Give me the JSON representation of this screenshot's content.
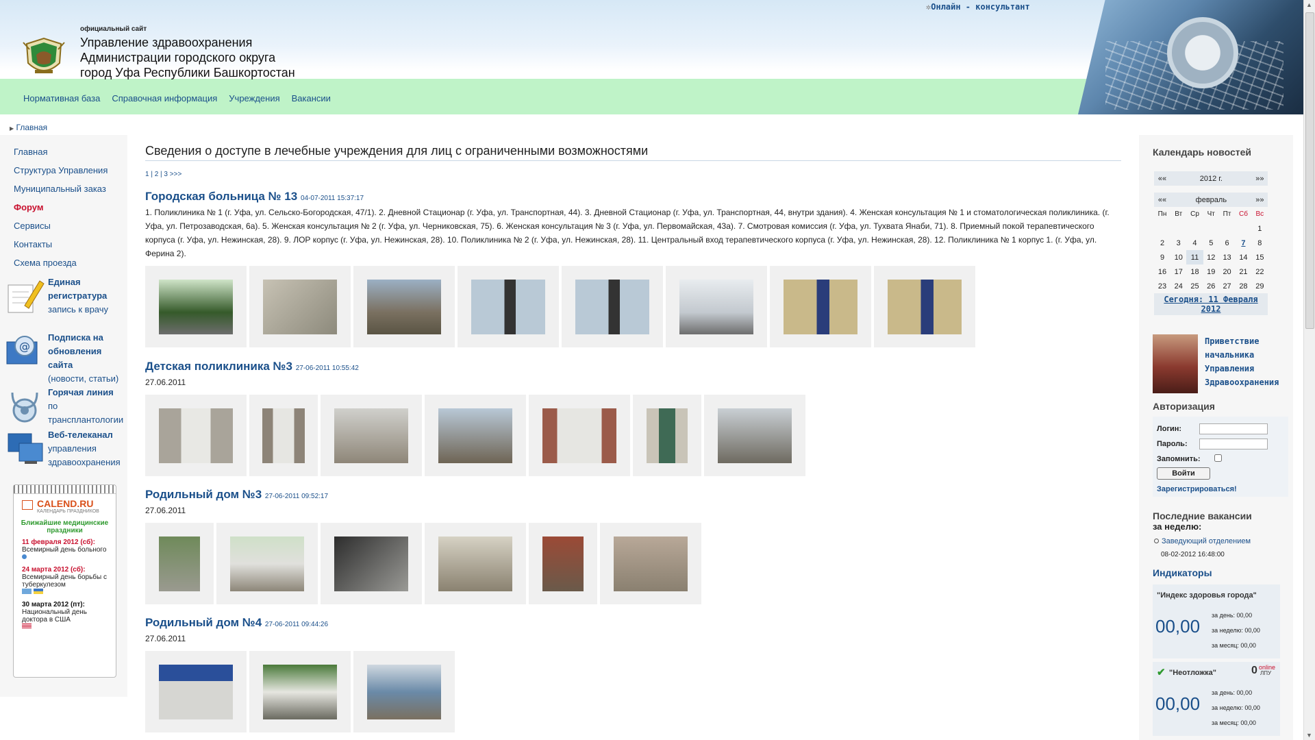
{
  "header": {
    "site_small": "официальный сайт",
    "title_line1": "Управление здравоохранения",
    "title_line2": "Администрации городского округа",
    "title_line3": "город Уфа Республики Башкортостан",
    "consultant": "Онлайн - консультант"
  },
  "topnav": [
    "Нормативная база",
    "Справочная информация",
    "Учреждения",
    "Вакансии"
  ],
  "breadcrumb": "Главная",
  "leftmenu": [
    "Главная",
    "Структура Управления",
    "Муниципальный заказ",
    "Форум",
    "Сервисы",
    "Контакты",
    "Схема проезда"
  ],
  "promos": [
    {
      "bold": [
        "Единая",
        "регистратура"
      ],
      "rest": [
        "запись к врачу"
      ]
    },
    {
      "bold": [
        "Подписка на",
        "обновления",
        "сайта"
      ],
      "rest": [
        "(новости, статьи)"
      ]
    },
    {
      "bold": [
        "Горячая линия"
      ],
      "rest": [
        "по",
        "трансплантологии"
      ]
    },
    {
      "bold": [
        "Веб-телеканал"
      ],
      "rest": [
        "управления",
        "здравоохранения"
      ]
    }
  ],
  "calend": {
    "brand": "CALEND.RU",
    "brand_sub": "КАЛЕНДАРЬ ПРАЗДНИКОВ",
    "near": "Ближайшие медицинские праздники",
    "events": [
      {
        "date": "11 февраля 2012 (сб):",
        "name": "Всемирный день больного"
      },
      {
        "date": "24 марта 2012 (сб):",
        "name": "Всемирный день борьбы с туберкулезом"
      },
      {
        "date": "30 марта 2012 (пт):",
        "name": "Национальный день доктора в США"
      }
    ]
  },
  "main": {
    "title": "Сведения о доступе в лечебные учреждения для лиц с ограниченными возможностями",
    "pager": "1 | 2 | 3 >>>",
    "entries": [
      {
        "title": "Городская больница № 13",
        "ts": "04-07-2011 15:37:17",
        "desc": "1. Поликлиника № 1 (г. Уфа, ул. Сельско-Богородская, 47/1). 2. Дневной Стационар (г. Уфа, ул. Транспортная, 44). 3. Дневной Стационар (г. Уфа, ул. Транспортная, 44, внутри здания). 4. Женская консультация № 1 и стоматологическая поликлиника. (г. Уфа, ул. Петрозаводская, 6а). 5. Женская консультация № 2 (г. Уфа, ул. Черниковская, 75). 6. Женская консультация № 3 (г. Уфа, ул. Первомайская, 43а). 7. Смотровая комиссия (г. Уфа, ул. Тухвата Янаби, 71). 8. Приемный покой терапевтического корпуса (г. Уфа, ул. Нежинская, 28). 9. ЛОР корпус (г. Уфа, ул. Нежинская, 28). 10. Поликлиника № 2 (г. Уфа, ул. Нежинская, 28). 11. Центральный вход терапевтического корпуса (г. Уфа, ул. Нежинская, 28). 12. Поликлиника № 1 корпус 1. (г. Уфа, ул. Ферина 2)."
      },
      {
        "title": "Детская поликлиника №3",
        "ts": "27-06-2011 10:55:42",
        "desc": "27.06.2011"
      },
      {
        "title": "Родильный дом №3",
        "ts": "27-06-2011 09:52:17",
        "desc": "27.06.2011"
      },
      {
        "title": "Родильный дом №4",
        "ts": "27-06-2011 09:44:26",
        "desc": "27.06.2011"
      }
    ]
  },
  "calendar": {
    "heading": "Календарь новостей",
    "prev": "«",
    "next": "»",
    "year": "2012 г.",
    "month": "февраль",
    "dow": [
      "Пн",
      "Вт",
      "Ср",
      "Чт",
      "Пт",
      "Сб",
      "Вс"
    ],
    "weeks": [
      [
        "",
        "",
        "",
        "",
        "",
        "",
        "1"
      ],
      [
        "2",
        "3",
        "4",
        "5",
        "6",
        "7",
        "8"
      ],
      [
        "9",
        "10",
        "11",
        "12",
        "13",
        "14",
        "15"
      ],
      [
        "16",
        "17",
        "18",
        "19",
        "20",
        "21",
        "22"
      ],
      [
        "23",
        "24",
        "25",
        "26",
        "27",
        "28",
        "29"
      ]
    ],
    "today": "Сегодня: 11 Февраля 2012"
  },
  "boss": "Приветствие начальника Управления Здравоохранения",
  "auth": {
    "heading": "Авторизация",
    "login_label": "Логин:",
    "password_label": "Пароль:",
    "remember_label": "Запомнить:",
    "button": "Войти",
    "register": "Зарегистрироваться!"
  },
  "vacancies": {
    "heading": "Последние вакансии",
    "sub": "за неделю:",
    "item": "Заведующий отделением",
    "date": "08-02-2012 16:48:00"
  },
  "indicators": {
    "heading": "Индикаторы",
    "blocks": [
      {
        "title": "\"Индекс здоровья города\"",
        "value": "00,00",
        "day": "за день: 00,00",
        "week": "за неделю: 00,00",
        "month": "за месяц: 00,00"
      },
      {
        "title": "\"Неотложка\"",
        "badge": "0",
        "badge_sub1": "online",
        "badge_sub2": "ЛПУ",
        "value": "00,00",
        "day": "за день: 00,00",
        "week": "за неделю: 00,00",
        "month": "за месяц: 00,00"
      }
    ]
  },
  "colors": {
    "nav_green": "#bff3c8",
    "link": "#1a4f8a",
    "forum_red": "#c8102e",
    "header_blue": "#d6e8f6"
  }
}
